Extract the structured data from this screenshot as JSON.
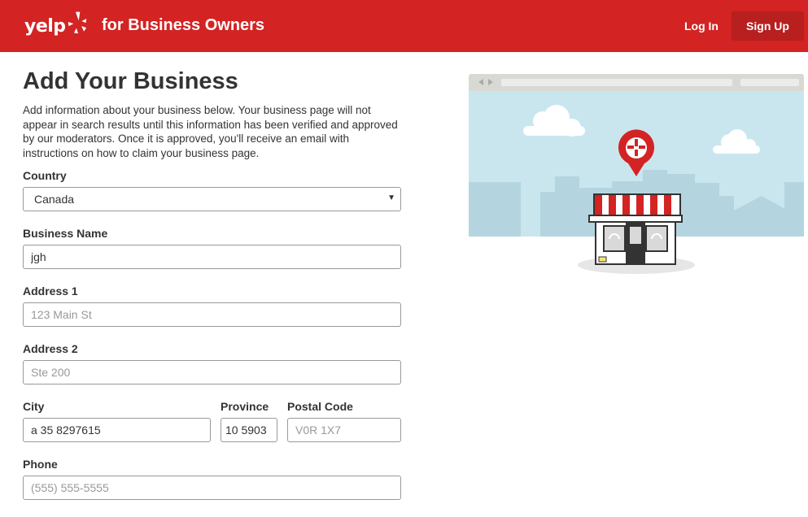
{
  "header": {
    "logo_text": "yelp",
    "brand_suffix": "for Business Owners",
    "login_label": "Log In",
    "signup_label": "Sign Up"
  },
  "form": {
    "title": "Add Your Business",
    "intro": "Add information about your business below. Your business page will not appear in search results until this information has been verified and approved by our moderators. Once it is approved, you'll receive an email with instructions on how to claim your business page.",
    "country": {
      "label": "Country",
      "value": "Canada"
    },
    "business_name": {
      "label": "Business Name",
      "value": "jgh",
      "placeholder": ""
    },
    "address1": {
      "label": "Address 1",
      "value": "",
      "placeholder": "123 Main St"
    },
    "address2": {
      "label": "Address 2",
      "value": "",
      "placeholder": "Ste 200"
    },
    "city": {
      "label": "City",
      "value": "a 35 8297615",
      "placeholder": ""
    },
    "province": {
      "label": "Province",
      "value": "10 5903",
      "placeholder": ""
    },
    "postal_code": {
      "label": "Postal Code",
      "value": "",
      "placeholder": "V0R 1X7"
    },
    "phone": {
      "label": "Phone",
      "value": "",
      "placeholder": "(555) 555-5555"
    }
  },
  "colors": {
    "brand_red": "#d32323",
    "button_dark_red": "#b81f1f",
    "sky_blue": "#c9e6ef",
    "skyline_blue": "#b4d5df"
  },
  "icons": [
    "yelp-burst-icon",
    "chevron-down-icon",
    "map-pin-icon",
    "storefront-icon",
    "cloud-icon"
  ]
}
